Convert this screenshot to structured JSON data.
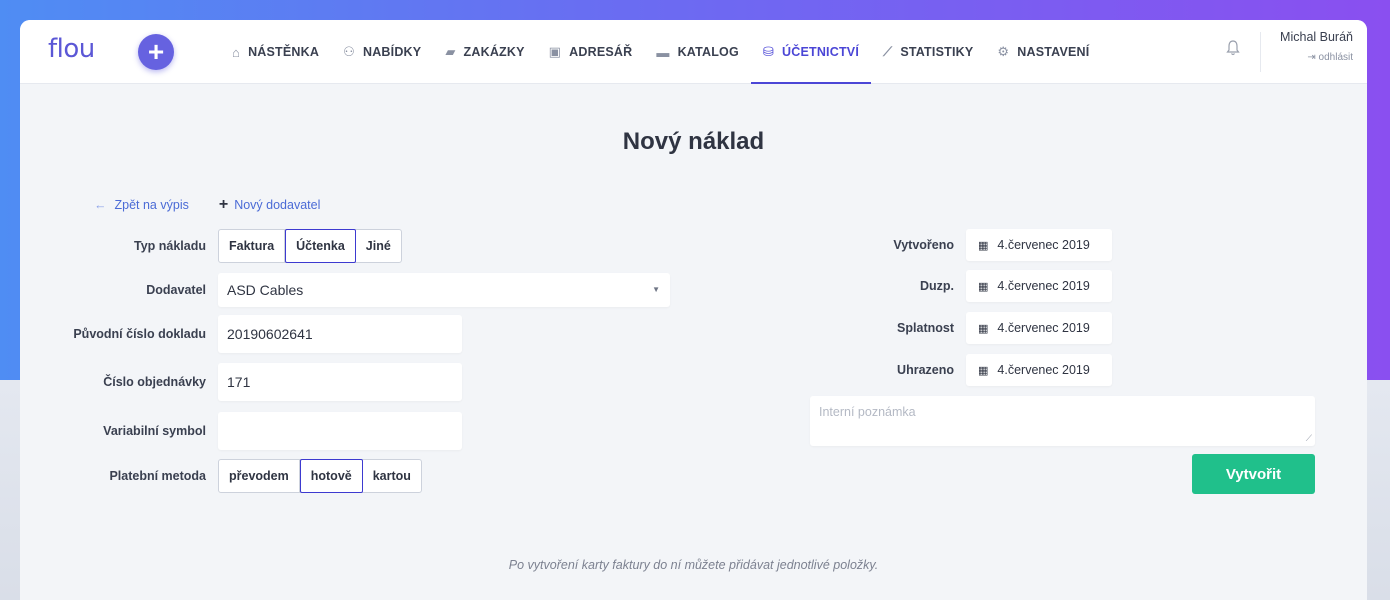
{
  "header": {
    "logo": "flou",
    "plus_label": "+",
    "nav": [
      {
        "label": "NÁSTĚNKA",
        "icon": "home-icon",
        "glyph": "⌂"
      },
      {
        "label": "NABÍDKY",
        "icon": "handshake-icon",
        "glyph": "⚇"
      },
      {
        "label": "ZAKÁZKY",
        "icon": "briefcase-icon",
        "glyph": "▰"
      },
      {
        "label": "ADRESÁŘ",
        "icon": "address-card-icon",
        "glyph": "▣"
      },
      {
        "label": "KATALOG",
        "icon": "folder-icon",
        "glyph": "▬"
      },
      {
        "label": "ÚČETNICTVÍ",
        "icon": "coins-icon",
        "glyph": "⛁",
        "active": true
      },
      {
        "label": "STATISTIKY",
        "icon": "chart-line-icon",
        "glyph": "⟋"
      },
      {
        "label": "NASTAVENÍ",
        "icon": "cogs-icon",
        "glyph": "⚙"
      }
    ],
    "bell_glyph": "🔔",
    "user_name": "Michal Buráň",
    "logout": "⇥ odhlásit"
  },
  "page": {
    "title": "Nový náklad",
    "back_link": "Zpět na výpis",
    "back_glyph": "←",
    "new_supplier_link": "Nový dodavatel",
    "new_supplier_glyph": "+"
  },
  "form": {
    "cost_type_label": "Typ nákladu",
    "cost_type_options": [
      "Faktura",
      "Účtenka",
      "Jiné"
    ],
    "cost_type_selected": "Účtenka",
    "supplier_label": "Dodavatel",
    "supplier_value": "ASD Cables",
    "supplier_caret": "▼",
    "orig_doc_label": "Původní číslo dokladu",
    "orig_doc_value": "20190602641",
    "order_no_label": "Číslo objednávky",
    "order_no_value": "171",
    "var_symbol_label": "Variabilní symbol",
    "var_symbol_value": "",
    "payment_label": "Platební metoda",
    "payment_options": [
      "převodem",
      "hotově",
      "kartou"
    ],
    "payment_selected": "hotově"
  },
  "dates": {
    "calendar_glyph": "▦",
    "created_label": "Vytvořeno",
    "created_value": "4.červenec 2019",
    "duzp_label": "Duzp.",
    "duzp_value": "4.červenec 2019",
    "due_label": "Splatnost",
    "due_value": "4.červenec 2019",
    "paid_label": "Uhrazeno",
    "paid_value": "4.červenec 2019"
  },
  "note": {
    "placeholder": "Interní poznámka",
    "grip": "⟋"
  },
  "actions": {
    "create_label": "Vytvořit"
  },
  "footnote": "Po vytvoření karty faktury do ní můžete přidávat jednotlivé položky.",
  "colors": {
    "accent": "#4b46d6",
    "primary_button": "#20c08b",
    "link": "#4b6bd6"
  }
}
